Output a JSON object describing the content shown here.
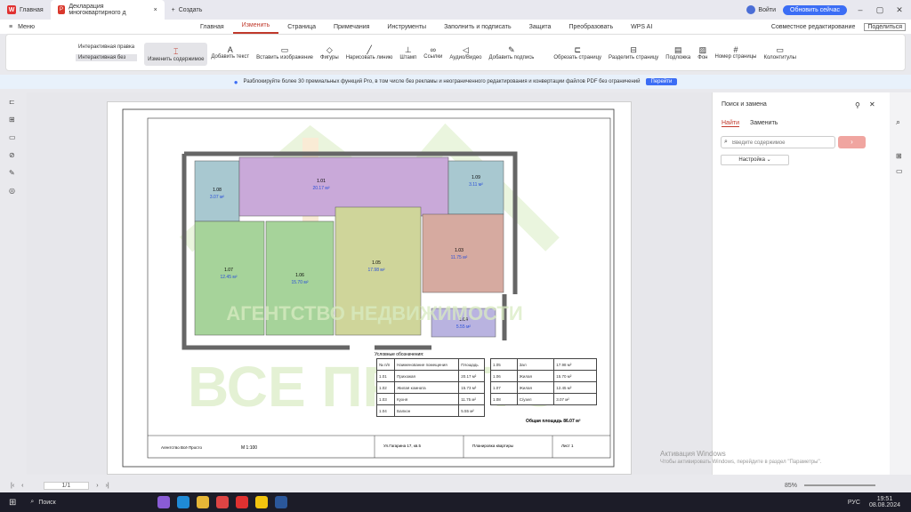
{
  "titlebar": {
    "home_tab": "Главная",
    "doc_tab": "Декларация многоквартирного д",
    "new_tab": "Создать",
    "user": "Войти",
    "upgrade": "Обновить сейчас"
  },
  "menu": [
    "Главная",
    "Изменить",
    "Страница",
    "Примечания",
    "Инструменты",
    "Заполнить и подписать",
    "Защита",
    "Преобразовать",
    "WPS AI"
  ],
  "menu_right": {
    "share": "Совместное редактирование",
    "save": "Поделиться"
  },
  "ribbon": {
    "modes": [
      "Интерактивная правка",
      "Интерактивная без"
    ],
    "tools": [
      "Изменить содержимое",
      "Добавить текст",
      "Вставить изображение",
      "Фигуры",
      "Нарисовать линию",
      "Штамп",
      "Ссылки",
      "Аудио/Видео",
      "Добавить подпись",
      "Обрезать страницу",
      "Разделить страницу",
      "Подложка",
      "Фон",
      "Номер страницы",
      "Колонтитулы"
    ]
  },
  "banner": {
    "text": "Разблокируйте более 30 премиальных функций Pro, в том числе без рекламы и неограниченного редактирования и конвертации файлов PDF без ограничений",
    "button": "Перейти"
  },
  "left_icons": [
    "bookmark-icon",
    "thumbnails-icon",
    "comment-icon",
    "attachment-icon",
    "signature-icon",
    "layers-icon"
  ],
  "right_panel": {
    "title": "Поиск и замена",
    "tabs": [
      "Найти",
      "Заменить"
    ],
    "placeholder": "Введите содержимое",
    "settings": "Настройка"
  },
  "plan": {
    "watermark_top": "АГЕНТСТВО НЕДВИЖИМОСТИ",
    "watermark_big": "ВСЕ ПРОСТО",
    "rooms": [
      {
        "id": "1.08",
        "area": "3.07 м²",
        "color": "#a8c8d0"
      },
      {
        "id": "1.01",
        "area": "20.17 м²",
        "color": "#c9a9d9"
      },
      {
        "id": "1.09",
        "area": "3.11 м²",
        "color": "#a8c8d0"
      },
      {
        "id": "1.07",
        "area": "12.45 м²",
        "color": "#a6d39a"
      },
      {
        "id": "1.06",
        "area": "15.70 м²",
        "color": "#a6d39a"
      },
      {
        "id": "1.05",
        "area": "17.98 м²",
        "color": "#cfd59a"
      },
      {
        "id": "1.03",
        "area": "11.75 м²",
        "color": "#d6aaa0"
      },
      {
        "id": "1.04",
        "area": "5.55 м²",
        "color": "#b9b3e0"
      }
    ],
    "legend_title": "Условные обозначения:",
    "legend_left": [
      [
        "№ п/п",
        "Наименование помещения",
        "Площадь"
      ],
      [
        "1.01",
        "Прихожая",
        "20.17 м²"
      ],
      [
        "1.02",
        "Жилая комната",
        "15.73 м²"
      ],
      [
        "1.03",
        "Кухня",
        "11.75 м²"
      ],
      [
        "1.04",
        "Балкон",
        "5.55 м²"
      ]
    ],
    "legend_right": [
      [
        "1.05",
        "Зал",
        "17.98 м²"
      ],
      [
        "1.06",
        "Жилая",
        "15.70 м²"
      ],
      [
        "1.07",
        "Жилая",
        "12.45 м²"
      ],
      [
        "1.08",
        "С/узел",
        "3.07 м²"
      ]
    ],
    "total": "Общая площадь 86.07 м²",
    "stamp": {
      "company": "Агентство Всё Просто",
      "sheet": "Лист 1",
      "scale": "М 1:100",
      "address": "Ул.Гагарина 17, кв.5",
      "doc": "План этажа",
      "title": "Планировка квартиры"
    }
  },
  "activation": {
    "title": "Активация Windows",
    "sub": "Чтобы активировать Windows, перейдите в раздел \"Параметры\"."
  },
  "status": {
    "page": "1/1",
    "zoom": "85%"
  },
  "taskbar": {
    "search": "Поиск",
    "time": "19:51",
    "date": "08.08.2024",
    "lang": "РУС"
  }
}
